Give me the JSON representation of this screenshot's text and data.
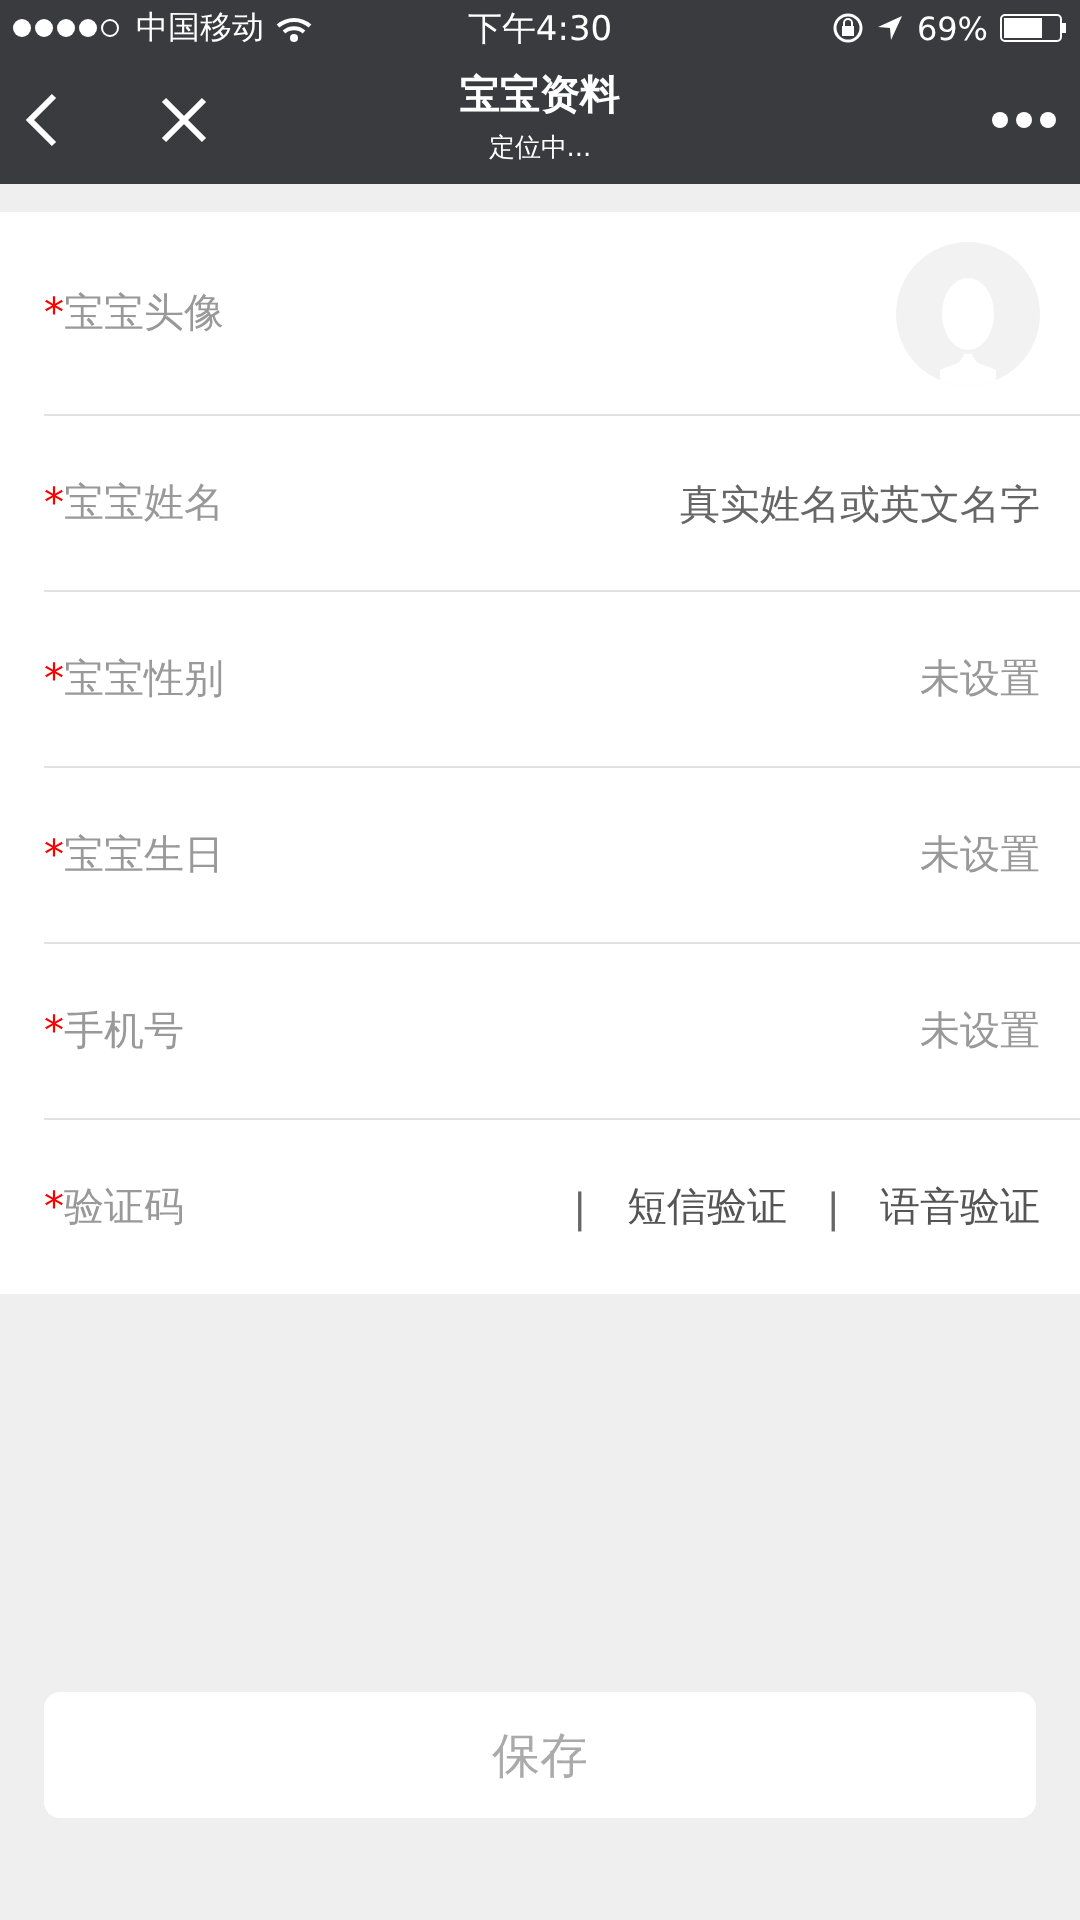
{
  "status_bar": {
    "carrier": "中国移动",
    "time": "下午4:30",
    "battery": "69%"
  },
  "nav": {
    "title": "宝宝资料",
    "subtitle": "定位中..."
  },
  "rows": [
    {
      "kind": "avatar",
      "required_mark": "*",
      "label": "宝宝头像"
    },
    {
      "kind": "input",
      "required_mark": "*",
      "label": "宝宝姓名",
      "placeholder": "真实姓名或英文名字"
    },
    {
      "kind": "value",
      "required_mark": "*",
      "label": "宝宝性别",
      "value": "未设置"
    },
    {
      "kind": "value",
      "required_mark": "*",
      "label": "宝宝生日",
      "value": "未设置"
    },
    {
      "kind": "value",
      "required_mark": "*",
      "label": "手机号",
      "value": "未设置"
    },
    {
      "kind": "links",
      "required_mark": "*",
      "label": "验证码",
      "separator": "|",
      "links": [
        "短信验证",
        "语音验证"
      ]
    }
  ],
  "save_button": {
    "label": "保存"
  }
}
